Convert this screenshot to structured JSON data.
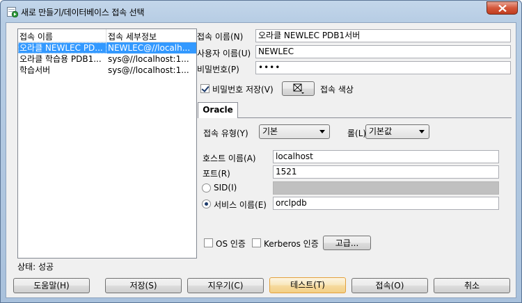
{
  "window": {
    "title": "새로 만들기/데이터베이스 접속 선택"
  },
  "list": {
    "headers": [
      "접속 이름",
      "접속 세부정보"
    ],
    "rows": [
      {
        "name": "오라클 NEWLEC PD...",
        "detail": "NEWLEC@//localh..."
      },
      {
        "name": "오라클 학습용 PDB1...",
        "detail": "sys@//localhost:1..."
      },
      {
        "name": "학습서버",
        "detail": "sys@//localhost:1..."
      }
    ]
  },
  "form": {
    "conn_name_label": "접속 이름(N)",
    "conn_name_value": "오라클 NEWLEC PDB1서버",
    "user_label": "사용자 이름(U)",
    "user_value": "NEWLEC",
    "password_label": "비밀번호(P)",
    "password_value": "••••",
    "save_password_label": "비밀번호 저장(V)",
    "save_password_checked": true,
    "conn_color_label": "접속 색상",
    "tab_label": "Oracle",
    "conn_type_label": "접속 유형(Y)",
    "conn_type_value": "기본",
    "role_label": "롤(L)",
    "role_value": "기본값",
    "host_label": "호스트 이름(A)",
    "host_value": "localhost",
    "port_label": "포트(R)",
    "port_value": "1521",
    "sid_label": "SID(I)",
    "sid_value": "",
    "service_label": "서비스 이름(E)",
    "service_value": "orclpdb",
    "service_selected": true,
    "os_auth_label": "OS 인증",
    "kerberos_label": "Kerberos 인증",
    "advanced_label": "고급..."
  },
  "status": {
    "text": "상태: 성공"
  },
  "buttons": {
    "help": "도움말(H)",
    "save": "저장(S)",
    "clear": "지우기(C)",
    "test": "테스트(T)",
    "connect": "접속(O)",
    "cancel": "취소"
  },
  "colors": {
    "selection": "#3399ff",
    "accent_focus": "#e3a03b"
  }
}
